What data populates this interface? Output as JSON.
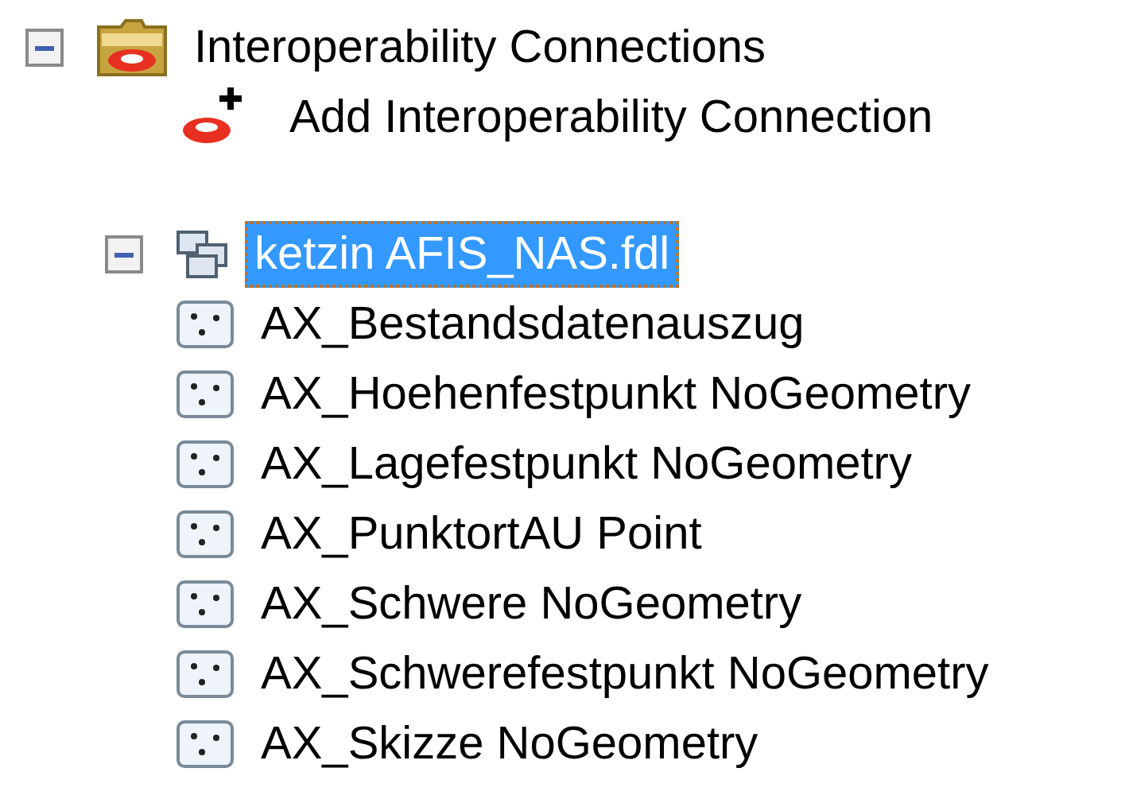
{
  "tree": [
    {
      "kind": "folder",
      "label": "Interoperability Connections",
      "expanded": true,
      "selected": false,
      "children": [
        {
          "kind": "add",
          "label": "Add Interoperability Connection",
          "selected": false
        },
        {
          "kind": "connection",
          "label": "ketzin AFIS_NAS.fdl",
          "expanded": true,
          "selected": true,
          "children": [
            {
              "kind": "feature-class",
              "label": "AX_Bestandsdatenauszug",
              "selected": false
            },
            {
              "kind": "feature-class",
              "label": "AX_Hoehenfestpunkt NoGeometry",
              "selected": false
            },
            {
              "kind": "feature-class",
              "label": "AX_Lagefestpunkt NoGeometry",
              "selected": false
            },
            {
              "kind": "feature-class",
              "label": "AX_PunktortAU Point",
              "selected": false
            },
            {
              "kind": "feature-class",
              "label": "AX_Schwere NoGeometry",
              "selected": false
            },
            {
              "kind": "feature-class",
              "label": "AX_Schwerefestpunkt NoGeometry",
              "selected": false
            },
            {
              "kind": "feature-class",
              "label": "AX_Skizze NoGeometry",
              "selected": false
            }
          ]
        }
      ]
    }
  ]
}
